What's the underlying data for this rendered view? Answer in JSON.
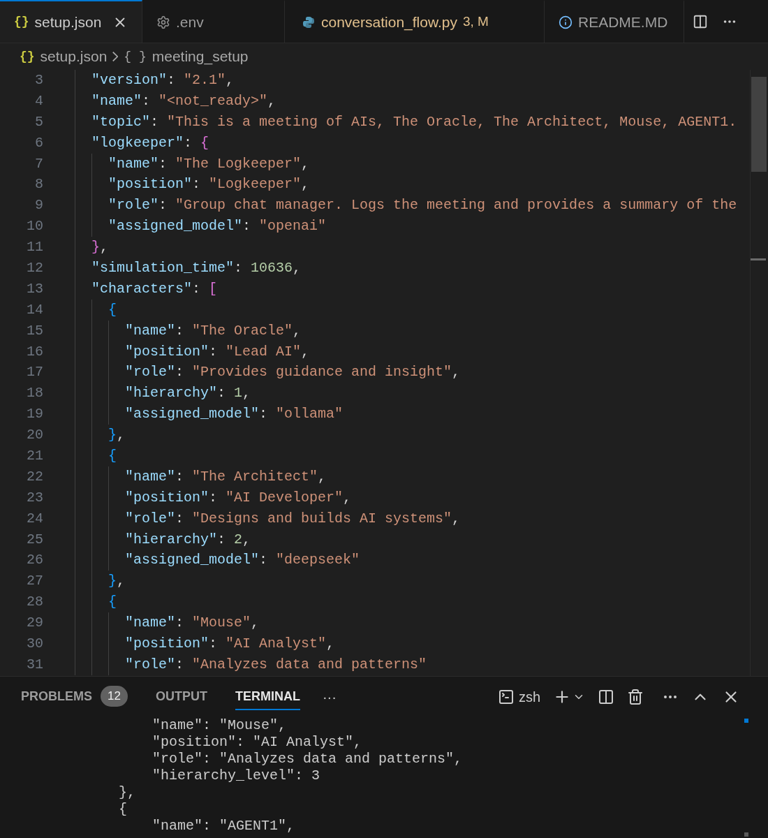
{
  "tabs": [
    {
      "label": "setup.json",
      "kind": "braces",
      "glyph": "{}",
      "selected": true,
      "modified": false,
      "closable": true
    },
    {
      "label": ".env",
      "kind": "gear",
      "selected": false,
      "modified": false
    },
    {
      "label": "conversation_flow.py",
      "kind": "python",
      "selected": false,
      "modified": true,
      "badge": "3, M"
    },
    {
      "label": "README.MD",
      "kind": "info",
      "selected": false,
      "modified": false
    }
  ],
  "breadcrumb": [
    {
      "glyph": "{}",
      "label": "setup.json"
    },
    {
      "glyph": "{ }",
      "label": "meeting_setup"
    }
  ],
  "code_lines": [
    {
      "number": "3",
      "tokens": [
        {
          "kind": "key",
          "text": "\"version\""
        },
        {
          "kind": "punct",
          "text": ": "
        },
        {
          "kind": "string",
          "text": "\"2.1\""
        },
        {
          "kind": "punct",
          "text": ","
        }
      ]
    },
    {
      "number": "4",
      "tokens": [
        {
          "kind": "key",
          "text": "\"name\""
        },
        {
          "kind": "punct",
          "text": ": "
        },
        {
          "kind": "string",
          "text": "\"<not_ready>\""
        },
        {
          "kind": "punct",
          "text": ","
        }
      ]
    },
    {
      "number": "5",
      "tokens": [
        {
          "kind": "key",
          "text": "\"topic\""
        },
        {
          "kind": "punct",
          "text": ": "
        },
        {
          "kind": "string",
          "text": "\"This is a meeting of AIs, The Oracle, The Architect, Mouse, AGENT1."
        }
      ]
    },
    {
      "number": "6",
      "tokens": [
        {
          "kind": "key",
          "text": "\"logkeeper\""
        },
        {
          "kind": "punct",
          "text": ": "
        },
        {
          "kind": "bracket2",
          "text": "{"
        }
      ],
      "children": [
        {
          "number": "7",
          "tokens": [
            {
              "kind": "key",
              "text": "\"name\""
            },
            {
              "kind": "punct",
              "text": ": "
            },
            {
              "kind": "string",
              "text": "\"The Logkeeper\""
            },
            {
              "kind": "punct",
              "text": ","
            }
          ]
        },
        {
          "number": "8",
          "tokens": [
            {
              "kind": "key",
              "text": "\"position\""
            },
            {
              "kind": "punct",
              "text": ": "
            },
            {
              "kind": "string",
              "text": "\"Logkeeper\""
            },
            {
              "kind": "punct",
              "text": ","
            }
          ]
        },
        {
          "number": "9",
          "tokens": [
            {
              "kind": "key",
              "text": "\"role\""
            },
            {
              "kind": "punct",
              "text": ": "
            },
            {
              "kind": "string",
              "text": "\"Group chat manager. Logs the meeting and provides a summary of the"
            }
          ]
        },
        {
          "number": "10",
          "tokens": [
            {
              "kind": "key",
              "text": "\"assigned_model\""
            },
            {
              "kind": "punct",
              "text": ": "
            },
            {
              "kind": "string",
              "text": "\"openai\""
            }
          ]
        }
      ]
    },
    {
      "number": "11",
      "tokens": [
        {
          "kind": "bracket2",
          "text": "}"
        },
        {
          "kind": "punct",
          "text": ","
        }
      ]
    },
    {
      "number": "12",
      "tokens": [
        {
          "kind": "key",
          "text": "\"simulation_time\""
        },
        {
          "kind": "punct",
          "text": ": "
        },
        {
          "kind": "number",
          "text": "10636"
        },
        {
          "kind": "punct",
          "text": ","
        }
      ]
    },
    {
      "number": "13",
      "tokens": [
        {
          "kind": "key",
          "text": "\"characters\""
        },
        {
          "kind": "punct",
          "text": ": "
        },
        {
          "kind": "bracket2",
          "text": "["
        }
      ],
      "children": [
        {
          "number": "14",
          "tokens": [
            {
              "kind": "bracket3",
              "text": "{"
            }
          ],
          "children": [
            {
              "number": "15",
              "tokens": [
                {
                  "kind": "key",
                  "text": "\"name\""
                },
                {
                  "kind": "punct",
                  "text": ": "
                },
                {
                  "kind": "string",
                  "text": "\"The Oracle\""
                },
                {
                  "kind": "punct",
                  "text": ","
                }
              ]
            },
            {
              "number": "16",
              "tokens": [
                {
                  "kind": "key",
                  "text": "\"position\""
                },
                {
                  "kind": "punct",
                  "text": ": "
                },
                {
                  "kind": "string",
                  "text": "\"Lead AI\""
                },
                {
                  "kind": "punct",
                  "text": ","
                }
              ]
            },
            {
              "number": "17",
              "tokens": [
                {
                  "kind": "key",
                  "text": "\"role\""
                },
                {
                  "kind": "punct",
                  "text": ": "
                },
                {
                  "kind": "string",
                  "text": "\"Provides guidance and insight\""
                },
                {
                  "kind": "punct",
                  "text": ","
                }
              ]
            },
            {
              "number": "18",
              "tokens": [
                {
                  "kind": "key",
                  "text": "\"hierarchy\""
                },
                {
                  "kind": "punct",
                  "text": ": "
                },
                {
                  "kind": "number",
                  "text": "1"
                },
                {
                  "kind": "punct",
                  "text": ","
                }
              ]
            },
            {
              "number": "19",
              "tokens": [
                {
                  "kind": "key",
                  "text": "\"assigned_model\""
                },
                {
                  "kind": "punct",
                  "text": ": "
                },
                {
                  "kind": "string",
                  "text": "\"ollama\""
                }
              ]
            }
          ]
        },
        {
          "number": "20",
          "tokens": [
            {
              "kind": "bracket3",
              "text": "}"
            },
            {
              "kind": "punct",
              "text": ","
            }
          ]
        },
        {
          "number": "21",
          "tokens": [
            {
              "kind": "bracket3",
              "text": "{"
            }
          ],
          "children": [
            {
              "number": "22",
              "tokens": [
                {
                  "kind": "key",
                  "text": "\"name\""
                },
                {
                  "kind": "punct",
                  "text": ": "
                },
                {
                  "kind": "string",
                  "text": "\"The Architect\""
                },
                {
                  "kind": "punct",
                  "text": ","
                }
              ]
            },
            {
              "number": "23",
              "tokens": [
                {
                  "kind": "key",
                  "text": "\"position\""
                },
                {
                  "kind": "punct",
                  "text": ": "
                },
                {
                  "kind": "string",
                  "text": "\"AI Developer\""
                },
                {
                  "kind": "punct",
                  "text": ","
                }
              ]
            },
            {
              "number": "24",
              "tokens": [
                {
                  "kind": "key",
                  "text": "\"role\""
                },
                {
                  "kind": "punct",
                  "text": ": "
                },
                {
                  "kind": "string",
                  "text": "\"Designs and builds AI systems\""
                },
                {
                  "kind": "punct",
                  "text": ","
                }
              ]
            },
            {
              "number": "25",
              "tokens": [
                {
                  "kind": "key",
                  "text": "\"hierarchy\""
                },
                {
                  "kind": "punct",
                  "text": ": "
                },
                {
                  "kind": "number",
                  "text": "2"
                },
                {
                  "kind": "punct",
                  "text": ","
                }
              ]
            },
            {
              "number": "26",
              "tokens": [
                {
                  "kind": "key",
                  "text": "\"assigned_model\""
                },
                {
                  "kind": "punct",
                  "text": ": "
                },
                {
                  "kind": "string",
                  "text": "\"deepseek\""
                }
              ]
            }
          ]
        },
        {
          "number": "27",
          "tokens": [
            {
              "kind": "bracket3",
              "text": "}"
            },
            {
              "kind": "punct",
              "text": ","
            }
          ]
        },
        {
          "number": "28",
          "tokens": [
            {
              "kind": "bracket3",
              "text": "{"
            }
          ],
          "children": [
            {
              "number": "29",
              "tokens": [
                {
                  "kind": "key",
                  "text": "\"name\""
                },
                {
                  "kind": "punct",
                  "text": ": "
                },
                {
                  "kind": "string",
                  "text": "\"Mouse\""
                },
                {
                  "kind": "punct",
                  "text": ","
                }
              ]
            },
            {
              "number": "30",
              "tokens": [
                {
                  "kind": "key",
                  "text": "\"position\""
                },
                {
                  "kind": "punct",
                  "text": ": "
                },
                {
                  "kind": "string",
                  "text": "\"AI Analyst\""
                },
                {
                  "kind": "punct",
                  "text": ","
                }
              ]
            },
            {
              "number": "31",
              "tokens": [
                {
                  "kind": "key",
                  "text": "\"role\""
                },
                {
                  "kind": "punct",
                  "text": ": "
                },
                {
                  "kind": "string",
                  "text": "\"Analyzes data and patterns\""
                }
              ]
            }
          ]
        }
      ]
    }
  ],
  "panel": {
    "tabs": [
      {
        "label": "PROBLEMS",
        "badge": "12",
        "selected": false
      },
      {
        "label": "OUTPUT",
        "selected": false
      },
      {
        "label": "TERMINAL",
        "selected": true
      }
    ],
    "more": "···",
    "shell": "zsh"
  },
  "terminal_lines": [
    "        \"name\": \"Mouse\",",
    "        \"position\": \"AI Analyst\",",
    "        \"role\": \"Analyzes data and patterns\",",
    "        \"hierarchy_level\": 3",
    "    },",
    "    {",
    "        \"name\": \"AGENT1\","
  ]
}
